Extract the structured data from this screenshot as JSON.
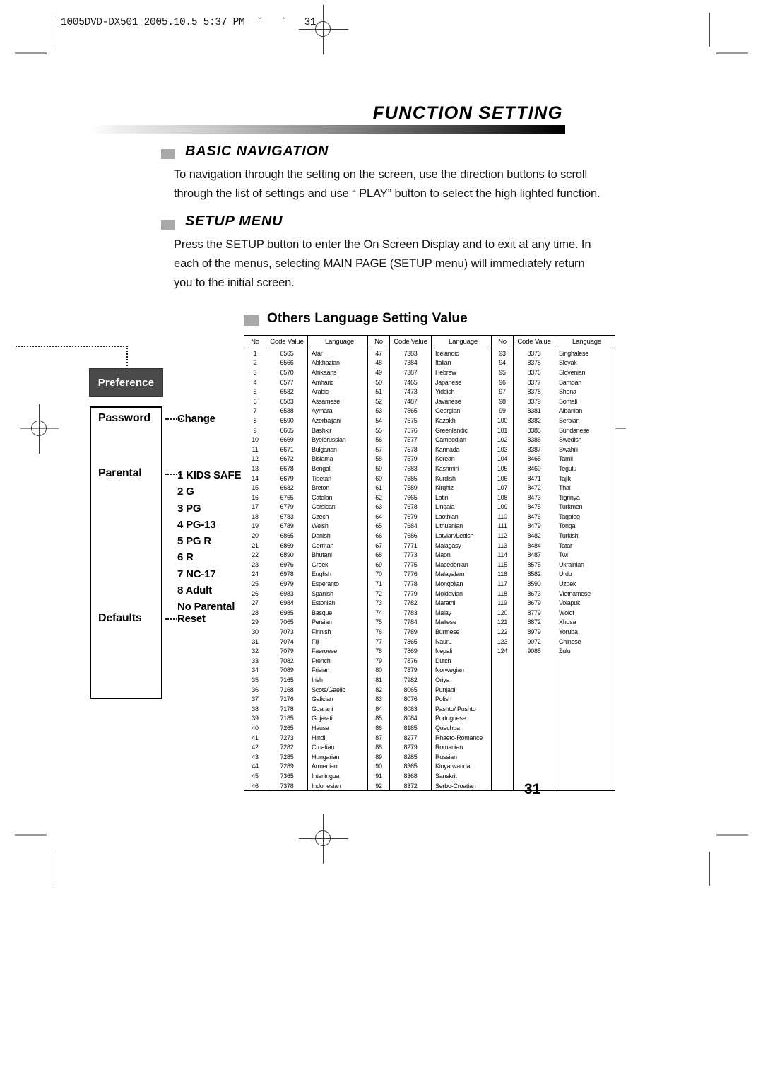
{
  "print_marks": {
    "file_stamp": "1005DVD-DX501 2005.10.5 5:37 PM  ˘   `   31"
  },
  "header": {
    "chapter_title": "FUNCTION SETTING"
  },
  "sections": [
    {
      "heading": "BASIC NAVIGATION",
      "lines": [
        "To navigation through the setting on the screen, use the direction buttons to scroll",
        "through the list of settings and use “ PLAY” button to select the high lighted function."
      ]
    },
    {
      "heading": "SETUP MENU",
      "lines": [
        "Press the SETUP button to enter the On Screen Display and to exit at any time. In",
        "each of the menus, selecting MAIN PAGE (SETUP menu) will immediately return",
        "you to the initial screen."
      ]
    }
  ],
  "subheading": "Others Language Setting Value",
  "preference_panel": {
    "tab_label": "Preference",
    "rows": [
      {
        "label": "Password",
        "options": [
          "Change"
        ]
      },
      {
        "label": "Parental",
        "options": [
          "1 KIDS SAFE",
          "2 G",
          "3 PG",
          "4 PG-13",
          "5 PG R",
          "6 R",
          "7 NC-17",
          "8 Adult",
          "No Parental"
        ]
      },
      {
        "label": "Defaults",
        "options": [
          "Reset"
        ]
      }
    ]
  },
  "language_table": {
    "headers": [
      "No",
      "Code Value",
      "Language",
      "No",
      "Code Value",
      "Language",
      "No",
      "Code Value",
      "Language"
    ],
    "rows": [
      [
        "1",
        "6565",
        "Afar",
        "47",
        "7383",
        "Icelandic",
        "93",
        "8373",
        "Singhalese"
      ],
      [
        "2",
        "6566",
        "Abkhazian",
        "48",
        "7384",
        "Italian",
        "94",
        "8375",
        "Slovak"
      ],
      [
        "3",
        "6570",
        "Afrikaans",
        "49",
        "7387",
        "Hebrew",
        "95",
        "8376",
        "Slovenian"
      ],
      [
        "4",
        "6577",
        "Amharic",
        "50",
        "7465",
        "Japanese",
        "96",
        "8377",
        "Samoan"
      ],
      [
        "5",
        "6582",
        "Arabic",
        "51",
        "7473",
        "Yiddish",
        "97",
        "8378",
        "Shona"
      ],
      [
        "6",
        "6583",
        "Assamese",
        "52",
        "7487",
        "Javanese",
        "98",
        "8379",
        "Somali"
      ],
      [
        "7",
        "6588",
        "Aymara",
        "53",
        "7565",
        "Georgian",
        "99",
        "8381",
        "Albanian"
      ],
      [
        "8",
        "6590",
        "Azerbaijani",
        "54",
        "7575",
        "Kazakh",
        "100",
        "8382",
        "Serbian"
      ],
      [
        "9",
        "6665",
        "Bashkir",
        "55",
        "7576",
        "Greenlandic",
        "101",
        "8385",
        "Sundanese"
      ],
      [
        "10",
        "6669",
        "Byelorussian",
        "56",
        "7577",
        "Cambodian",
        "102",
        "8386",
        "Swedish"
      ],
      [
        "11",
        "6671",
        "Bulgarian",
        "57",
        "7578",
        "Kannada",
        "103",
        "8387",
        "Swahili"
      ],
      [
        "12",
        "6672",
        "Bislama",
        "58",
        "7579",
        "Korean",
        "104",
        "8465",
        "Tamil"
      ],
      [
        "13",
        "6678",
        "Bengali",
        "59",
        "7583",
        "Kashmiri",
        "105",
        "8469",
        "Tegulu"
      ],
      [
        "14",
        "6679",
        "Tibetan",
        "60",
        "7585",
        "Kurdish",
        "106",
        "8471",
        "Tajik"
      ],
      [
        "15",
        "6682",
        "Breton",
        "61",
        "7589",
        "Kirghiz",
        "107",
        "8472",
        "Thai"
      ],
      [
        "16",
        "6765",
        "Catalan",
        "62",
        "7665",
        "Latin",
        "108",
        "8473",
        "Tigrinya"
      ],
      [
        "17",
        "6779",
        "Corsican",
        "63",
        "7678",
        "Lingala",
        "109",
        "8475",
        "Turkmen"
      ],
      [
        "18",
        "6783",
        "Czech",
        "64",
        "7679",
        "Laothian",
        "110",
        "8476",
        "Tagalog"
      ],
      [
        "19",
        "6789",
        "Welsh",
        "65",
        "7684",
        "Lithuanian",
        "111",
        "8479",
        "Tonga"
      ],
      [
        "20",
        "6865",
        "Danish",
        "66",
        "7686",
        "Latvian/Lettish",
        "112",
        "8482",
        "Turkish"
      ],
      [
        "21",
        "6869",
        "German",
        "67",
        "7771",
        "Malagasy",
        "113",
        "8484",
        "Tatar"
      ],
      [
        "22",
        "6890",
        "Bhutani",
        "68",
        "7773",
        "Maon",
        "114",
        "8487",
        "Twi"
      ],
      [
        "23",
        "6976",
        "Greek",
        "69",
        "7775",
        "Macedonian",
        "115",
        "8575",
        "Ukrainian"
      ],
      [
        "24",
        "6978",
        "English",
        "70",
        "7776",
        "Malayalam",
        "116",
        "8582",
        "Urdu"
      ],
      [
        "25",
        "6979",
        "Esperanto",
        "71",
        "7778",
        "Mongolian",
        "117",
        "8590",
        "Uzbek"
      ],
      [
        "26",
        "6983",
        "Spanish",
        "72",
        "7779",
        "Moldavian",
        "118",
        "8673",
        "Vietnamese"
      ],
      [
        "27",
        "6984",
        "Estonian",
        "73",
        "7782",
        "Marathi",
        "119",
        "8679",
        "Volapuk"
      ],
      [
        "28",
        "6985",
        "Basque",
        "74",
        "7783",
        "Malay",
        "120",
        "8779",
        "Wolof"
      ],
      [
        "29",
        "7065",
        "Persian",
        "75",
        "7784",
        "Maltese",
        "121",
        "8872",
        "Xhosa"
      ],
      [
        "30",
        "7073",
        "Finnish",
        "76",
        "7789",
        "Burmese",
        "122",
        "8979",
        "Yoruba"
      ],
      [
        "31",
        "7074",
        "Fiji",
        "77",
        "7865",
        "Nauru",
        "123",
        "9072",
        "Chinese"
      ],
      [
        "32",
        "7079",
        "Faeroese",
        "78",
        "7869",
        "Nepali",
        "124",
        "9085",
        "Zulu"
      ],
      [
        "33",
        "7082",
        "French",
        "79",
        "7876",
        "Dutch",
        "",
        "",
        ""
      ],
      [
        "34",
        "7089",
        "Frisian",
        "80",
        "7879",
        "Norwegian",
        "",
        "",
        ""
      ],
      [
        "35",
        "7165",
        "Irish",
        "81",
        "7982",
        "Oriya",
        "",
        "",
        ""
      ],
      [
        "36",
        "7168",
        "Scots/Gaelic",
        "82",
        "8065",
        "Punjabi",
        "",
        "",
        ""
      ],
      [
        "37",
        "7176",
        "Galician",
        "83",
        "8076",
        "Polish",
        "",
        "",
        ""
      ],
      [
        "38",
        "7178",
        "Guarani",
        "84",
        "8083",
        "Pashto/ Pushto",
        "",
        "",
        ""
      ],
      [
        "39",
        "7185",
        "Gujarati",
        "85",
        "8084",
        "Portuguese",
        "",
        "",
        ""
      ],
      [
        "40",
        "7265",
        "Hausa",
        "86",
        "8185",
        "Quechua",
        "",
        "",
        ""
      ],
      [
        "41",
        "7273",
        "Hindi",
        "87",
        "8277",
        "Rhaeto-Romance",
        "",
        "",
        ""
      ],
      [
        "42",
        "7282",
        "Croatian",
        "88",
        "8279",
        "Romanian",
        "",
        "",
        ""
      ],
      [
        "43",
        "7285",
        "Hungarian",
        "89",
        "8285",
        "Russian",
        "",
        "",
        ""
      ],
      [
        "44",
        "7289",
        "Armenian",
        "90",
        "8365",
        "Kinyarwanda",
        "",
        "",
        ""
      ],
      [
        "45",
        "7365",
        "Interlingua",
        "91",
        "8368",
        "Sanskrit",
        "",
        "",
        ""
      ],
      [
        "46",
        "7378",
        "Indonesian",
        "92",
        "8372",
        "Serbo-Croatian",
        "",
        "",
        ""
      ]
    ]
  },
  "page_number": "31"
}
